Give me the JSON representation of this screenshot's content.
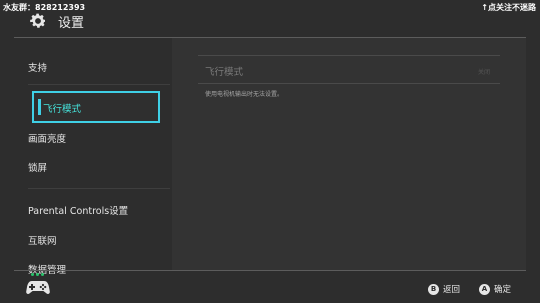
{
  "overlay": {
    "left_text": "水友群：828212393",
    "right_text": "↑点关注不迷路"
  },
  "header": {
    "title": "设置",
    "icon": "gear-icon"
  },
  "sidebar": {
    "items": [
      {
        "label": "支持"
      },
      {
        "label": "飞行模式",
        "selected": true
      },
      {
        "label": "画面亮度"
      },
      {
        "label": "锁屏"
      },
      {
        "label": "Parental Controls设置"
      },
      {
        "label": "互联网"
      },
      {
        "label": "数据管理"
      }
    ]
  },
  "content": {
    "row_label": "飞行模式",
    "row_value": "关闭",
    "description": "使用电视机输出时无法设置。"
  },
  "footer": {
    "controller_icon": "controller-icon",
    "b_key": "B",
    "back_label": "返回",
    "a_key": "A",
    "ok_label": "确定"
  },
  "colors": {
    "background": "#2d2d2d",
    "selection": "#3fd0e6",
    "selected_text": "#46e3dc",
    "dots": "#29c36a"
  }
}
